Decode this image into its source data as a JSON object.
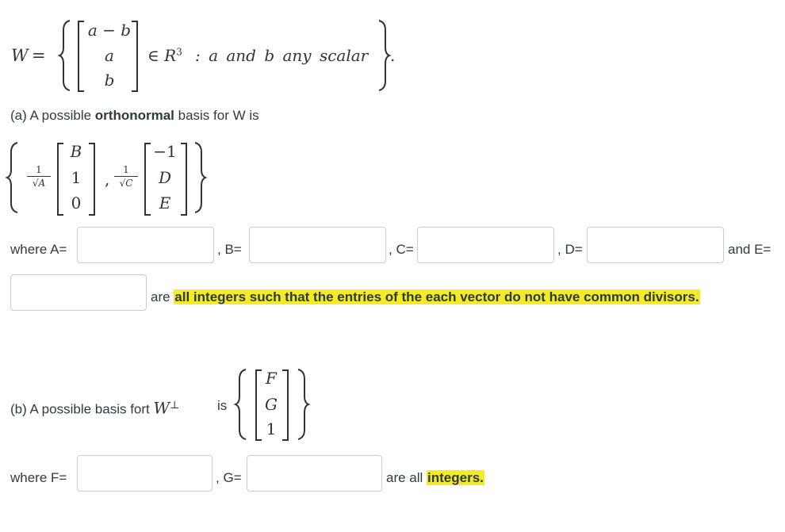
{
  "definition": {
    "lhs": "W",
    "equals": "=",
    "vector": [
      "a − b",
      "a",
      "b"
    ],
    "membership": "∈ R",
    "superscript": "3",
    "condition": ": a  and  b  any  scalar",
    "period": "."
  },
  "part_a": {
    "prefix": "(a) A possible ",
    "bold_word": "orthonormal",
    "suffix": " basis for W  is",
    "basis": [
      {
        "coef_num": "1",
        "coef_den": "√A",
        "entries": [
          "B",
          "1",
          "0"
        ]
      },
      {
        "coef_num": "1",
        "coef_den": "√C",
        "entries": [
          "−1",
          "D",
          "E"
        ]
      }
    ],
    "separator": ",",
    "labels": {
      "where_a": "where A=",
      "b": ",  B=",
      "c": ", C=",
      "d": ", D=",
      "and_e": "and E="
    },
    "inputs": {
      "A": {
        "value": "",
        "placeholder": ""
      },
      "B": {
        "value": "",
        "placeholder": ""
      },
      "C": {
        "value": "",
        "placeholder": ""
      },
      "D": {
        "value": "",
        "placeholder": ""
      },
      "E": {
        "value": "",
        "placeholder": ""
      }
    },
    "note_prefix": "are ",
    "note_highlight": "all integers such that the entries of the each vector do not have common divisors."
  },
  "part_b": {
    "prefix": "(b) A possible basis fort ",
    "symbol": "W",
    "symbol_sup": "⊥",
    "suffix": "is",
    "basis_entries": [
      "F",
      "G",
      "1"
    ],
    "labels": {
      "where_f": "where F=",
      "g": ", G="
    },
    "inputs": {
      "F": {
        "value": "",
        "placeholder": ""
      },
      "G": {
        "value": "",
        "placeholder": ""
      }
    },
    "note_prefix": "are all ",
    "note_highlight": "integers."
  },
  "colors": {
    "text": "#2d3b45",
    "highlight": "#f4ea2a",
    "input_border": "#c7cdd1"
  }
}
